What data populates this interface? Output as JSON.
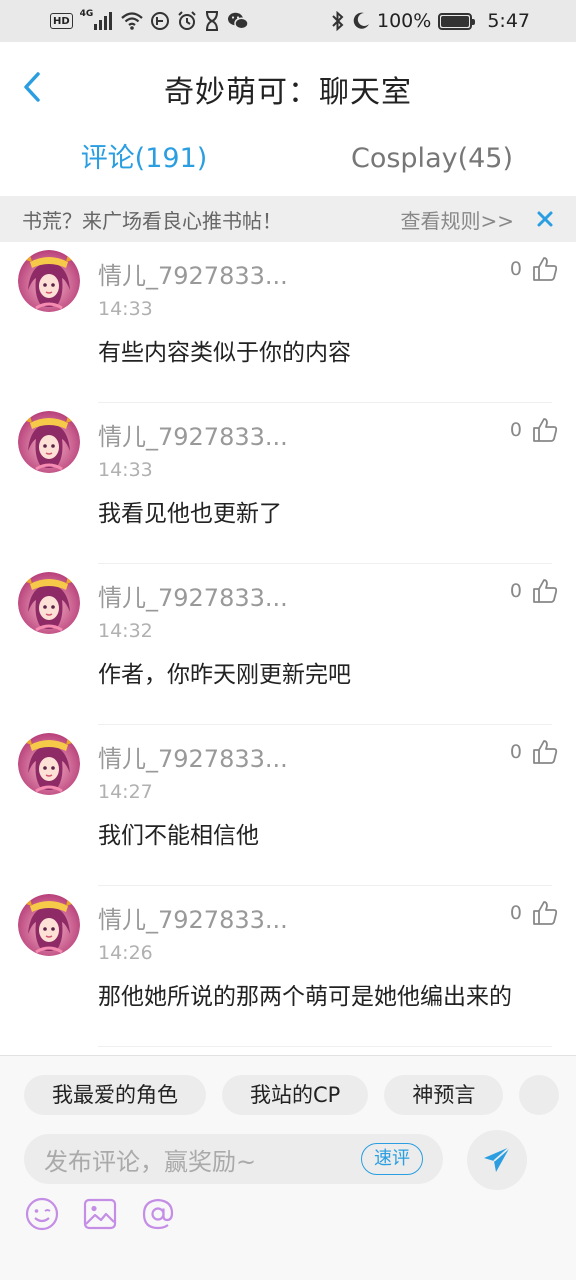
{
  "status_bar": {
    "left_icons": [
      "hd-icon",
      "signal-4g-icon",
      "wifi-icon",
      "data-saver-icon",
      "alarm-icon",
      "hourglass-icon",
      "wechat-icon"
    ],
    "hd": "HD",
    "network": "4G",
    "battery": "100%",
    "battery_level": 1.0,
    "time": "5:47"
  },
  "header": {
    "title": "奇妙萌可：聊天室"
  },
  "tabs": [
    {
      "label": "评论(191)",
      "active": true
    },
    {
      "label": "Cosplay(45)",
      "active": false
    }
  ],
  "notice": {
    "text": "书荒？来广场看良心推书帖！",
    "link": "查看规则>>"
  },
  "comments": [
    {
      "name": "情儿_7927833...",
      "time": "14:33",
      "text": "有些内容类似于你的内容",
      "likes": "0"
    },
    {
      "name": "情儿_7927833...",
      "time": "14:33",
      "text": "我看见他也更新了",
      "likes": "0"
    },
    {
      "name": "情儿_7927833...",
      "time": "14:32",
      "text": "作者，你昨天刚更新完吧",
      "likes": "0"
    },
    {
      "name": "情儿_7927833...",
      "time": "14:27",
      "text": "我们不能相信他",
      "likes": "0"
    },
    {
      "name": "情儿_7927833...",
      "time": "14:26",
      "text": "那他她所说的那两个萌可是她他编出来的",
      "likes": "0"
    }
  ],
  "bottom": {
    "chips": [
      "我最爱的角色",
      "我站的CP",
      "神预言"
    ],
    "input_placeholder": "发布评论，赢奖励~",
    "quick_label": "速评"
  },
  "colors": {
    "accent": "#2a9ee0",
    "notice_bg": "#eeeeee",
    "tool_icon": "#c48ee6"
  }
}
